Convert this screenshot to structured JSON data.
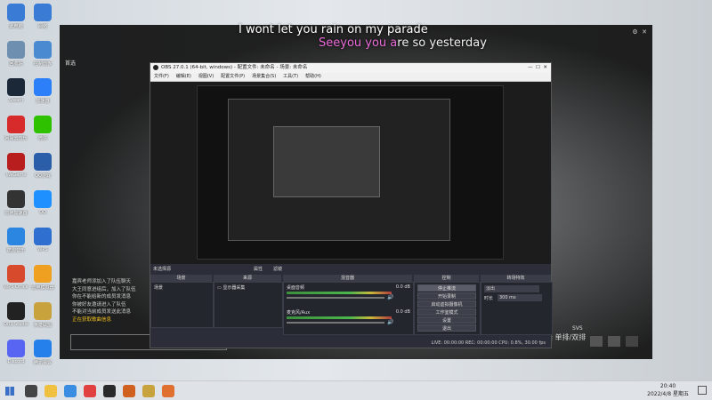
{
  "desktop_icons": [
    {
      "label": "此电脑",
      "icon": "computer-icon",
      "color": "#3a7bd5"
    },
    {
      "label": "网络",
      "icon": "network-icon",
      "color": "#3a7bd5"
    },
    {
      "label": "回收站",
      "icon": "recycle-bin-icon",
      "color": "#6f8fb0"
    },
    {
      "label": "控制面板",
      "icon": "control-panel-icon",
      "color": "#4a8ad0"
    },
    {
      "label": "Steam",
      "icon": "steam-icon",
      "color": "#1b2838"
    },
    {
      "label": "加速器",
      "icon": "accelerator-icon",
      "color": "#2d7ff9"
    },
    {
      "label": "网易云音乐",
      "icon": "netease-music-icon",
      "color": "#d72b2b"
    },
    {
      "label": "微信",
      "icon": "wechat-icon",
      "color": "#2dc100"
    },
    {
      "label": "WeGame",
      "icon": "wegame-icon",
      "color": "#b91e1e"
    },
    {
      "label": "QQ游戏",
      "icon": "qq-game-icon",
      "color": "#2b5ea8"
    },
    {
      "label": "雷神加速器",
      "icon": "thunder-icon",
      "color": "#333"
    },
    {
      "label": "QQ",
      "icon": "qq-icon",
      "color": "#1e90ff"
    },
    {
      "label": "酷狗音乐",
      "icon": "kugou-icon",
      "color": "#2a86e0"
    },
    {
      "label": "WPS",
      "icon": "wps-icon",
      "color": "#2f6fd0"
    },
    {
      "label": "WPS Office",
      "icon": "wps-office-icon",
      "color": "#d84a2c"
    },
    {
      "label": "雷电模拟器",
      "icon": "emulator-icon",
      "color": "#f0a020"
    },
    {
      "label": "OBS Studio",
      "icon": "obs-icon",
      "color": "#222"
    },
    {
      "label": "英雄联盟",
      "icon": "lol-icon",
      "color": "#c8a23c"
    },
    {
      "label": "Discord",
      "icon": "chat-app-icon",
      "color": "#5865f2"
    },
    {
      "label": "腾讯会议",
      "icon": "meeting-icon",
      "color": "#2680eb"
    }
  ],
  "overlay": {
    "lyric_line1": "I wont let you rain on my parade",
    "lyric_line2_pink": "Seeyou you a",
    "lyric_line2_rest": "re so yesterday",
    "top_left_label": "首选",
    "chat": [
      "嘉宾老师添加入了队伍聊天",
      "大王同意进组后，加入了队伍",
      "你在不能给新的成员发消息",
      "你被好友邀请进入了队伍",
      "不能对当前成员发送此消息",
      "正在获取歌曲信息"
    ],
    "corner_text": "排位赛 单排/双排",
    "corner_tag": "SVS"
  },
  "obs": {
    "title": "OBS 27.0.1 (64-bit, windows) - 配置文件: 未命名 - 场景: 未命名",
    "menu": [
      "文件(F)",
      "编辑(E)",
      "视图(V)",
      "配置文件(P)",
      "场景集合(S)",
      "工具(T)",
      "帮助(H)"
    ],
    "docks": {
      "scenes": "场景",
      "sources": "来源",
      "mixer": "混音器",
      "transitions": "转场特效",
      "controls": "控制"
    },
    "scene_item": "场景",
    "source_item": "显示器采集",
    "no_source": "未选择源",
    "props_btn": "属性",
    "filters_btn": "滤镜",
    "mixer": [
      {
        "name": "桌面音频",
        "level": "0.0 dB"
      },
      {
        "name": "麦克风/Aux",
        "level": "0.0 dB"
      }
    ],
    "transition": "淡出",
    "duration_label": "时长",
    "duration": "300 ms",
    "controls": [
      "停止推流",
      "开始录制",
      "启动虚拟摄像机",
      "工作室模式",
      "设置",
      "退出"
    ],
    "status": "LIVE: 00:00:00   REC: 00:00:00   CPU: 0.8%, 30.00 fps"
  },
  "taskbar": {
    "time": "20:40",
    "date": "2022/4/8 星期五"
  }
}
